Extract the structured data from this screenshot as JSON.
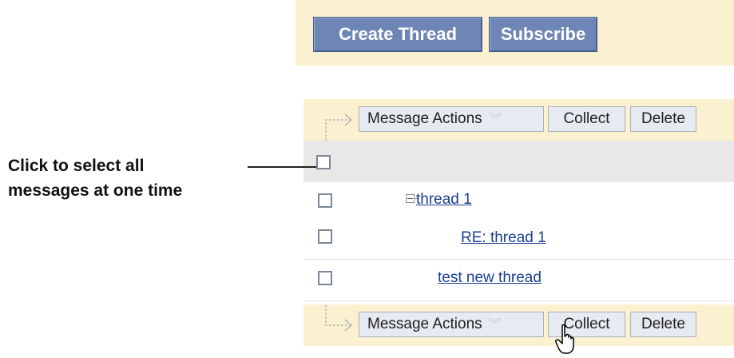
{
  "top_bar": {
    "create_thread": "Create Thread",
    "subscribe": "Subscribe"
  },
  "action_bar": {
    "message_actions": "Message Actions",
    "collect": "Collect",
    "delete": "Delete",
    "dropdown_icon": "double-chevron-down-icon"
  },
  "messages": [
    {
      "title": "thread 1",
      "expandable": true
    },
    {
      "title": "RE: thread 1",
      "expandable": false
    },
    {
      "title": "test new thread",
      "expandable": false
    }
  ],
  "callout": {
    "line1": "Click to select all",
    "line2": "messages at one time"
  },
  "colors": {
    "bar_background": "#fbf0d0",
    "primary_button": "#6d86b6",
    "link": "#1b3f93",
    "header_row": "#e8e8e8"
  }
}
